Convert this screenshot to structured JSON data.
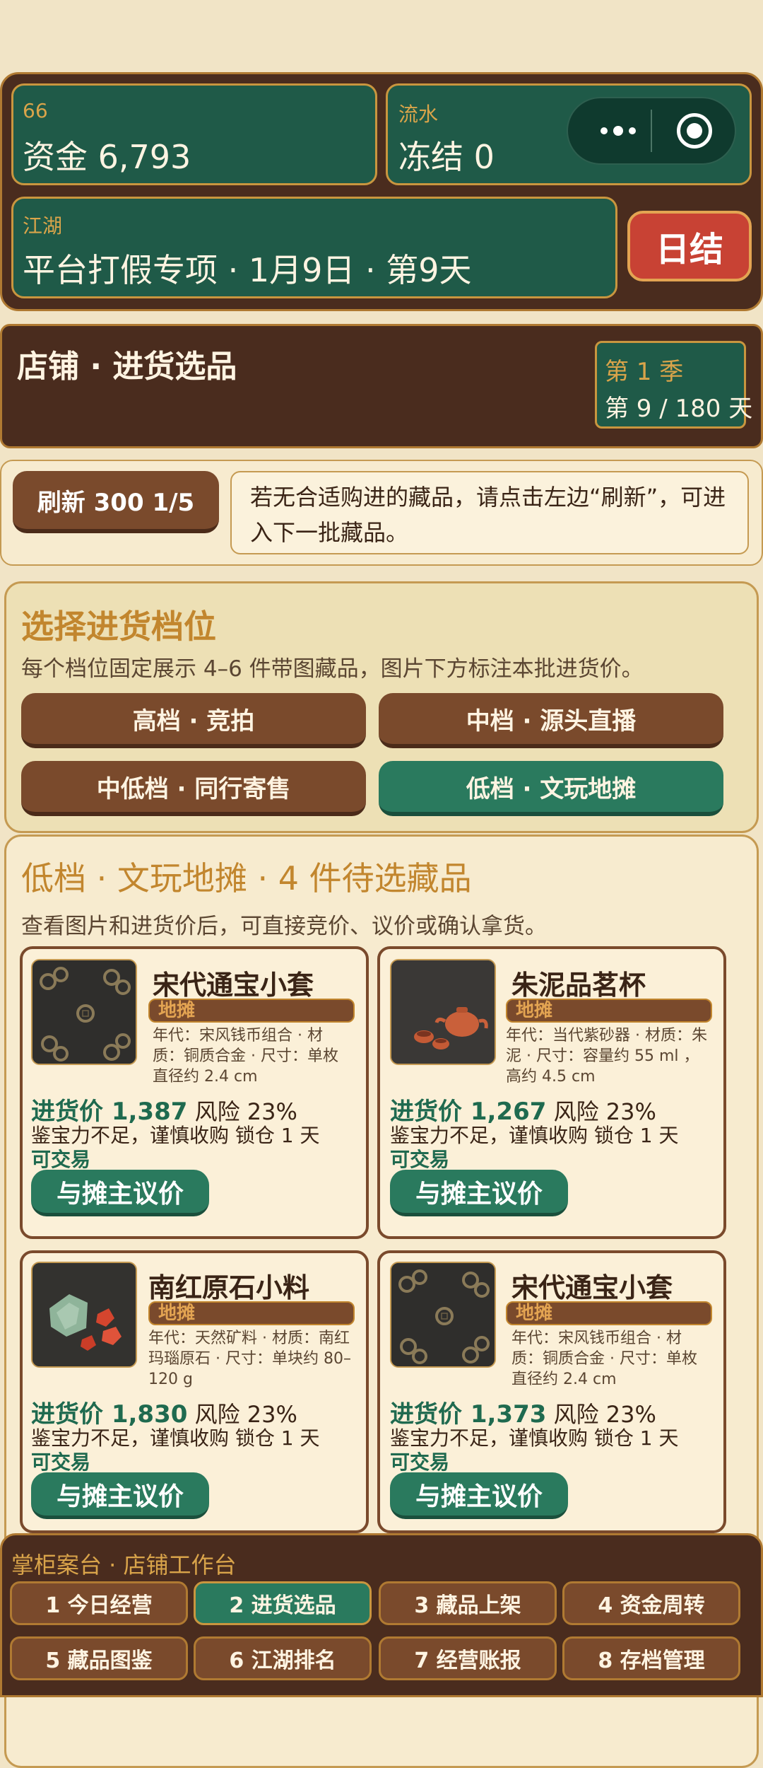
{
  "colors": {
    "background": "#f1e4c6",
    "panel_brown": "#4a2c1e",
    "card_green": "#1f5a48",
    "accent_gold": "#c9963f",
    "settle_red": "#c84234",
    "button_brown": "#7a4a2c",
    "active_green": "#2a7a5e"
  },
  "header": {
    "player_label": "66",
    "funds_text": "资金 6,793",
    "flow_label": "流水",
    "frozen_text": "冻结 0",
    "jianghu_label": "江湖",
    "event_text": "平台打假专项 · 1月9日 · 第9天",
    "settle_label": "日结",
    "capsule_more_icon": "more-dots-icon",
    "capsule_close_icon": "target-close-icon"
  },
  "shop": {
    "title": "店铺 · 进货选品",
    "season_label": "第 1 季",
    "day_progress": "第 9 / 180 天"
  },
  "refresh": {
    "button_label": "刷新 300 1/5",
    "tip": "若无合适购进的藏品，请点击左边“刷新”，可进入下一批藏品。"
  },
  "tiers": {
    "title": "选择进货档位",
    "description": "每个档位固定展示 4–6 件带图藏品，图片下方标注本批进货价。",
    "buttons": [
      {
        "label": "高档 · 竞拍"
      },
      {
        "label": "中档 · 源头直播"
      },
      {
        "label": "中低档 · 同行寄售"
      },
      {
        "label": "低档 · 文玩地摊"
      }
    ],
    "active_index": 3
  },
  "listing": {
    "title": "低档 · 文玩地摊 · 4 件待选藏品",
    "description": "查看图片和进货价后，可直接竞价、议价或确认拿货。",
    "items": [
      {
        "name": "宋代通宝小套",
        "tag": "地摊",
        "meta": "年代：宋风钱币组合 · 材质：铜质合金 · 尺寸：单枚直径约 2.4 cm",
        "price_label": "进货价 1,387",
        "risk": "风险 23%",
        "warning": "鉴宝力不足，谨慎收购 锁仓 1 天",
        "status": "可交易",
        "action": "与摊主议价",
        "image": "coins"
      },
      {
        "name": "朱泥品茗杯",
        "tag": "地摊",
        "meta": "年代：当代紫砂器 · 材质：朱泥 · 尺寸：容量约 55 ml ，高约 4.5 cm",
        "price_label": "进货价 1,267",
        "risk": "风险 23%",
        "warning": "鉴宝力不足，谨慎收购 锁仓 1 天",
        "status": "可交易",
        "action": "与摊主议价",
        "image": "teapot"
      },
      {
        "name": "南红原石小料",
        "tag": "地摊",
        "meta": "年代：天然矿料 · 材质：南红玛瑙原石 · 尺寸：单块约 80–120 g",
        "price_label": "进货价 1,830",
        "risk": "风险 23%",
        "warning": "鉴宝力不足，谨慎收购 锁仓 1 天",
        "status": "可交易",
        "action": "与摊主议价",
        "image": "stones"
      },
      {
        "name": "宋代通宝小套",
        "tag": "地摊",
        "meta": "年代：宋风钱币组合 · 材质：铜质合金 · 尺寸：单枚直径约 2.4 cm",
        "price_label": "进货价 1,373",
        "risk": "风险 23%",
        "warning": "鉴宝力不足，谨慎收购 锁仓 1 天",
        "status": "可交易",
        "action": "与摊主议价",
        "image": "coins"
      }
    ]
  },
  "bottom_nav": {
    "heading": "掌柜案台 · 店铺工作台",
    "tabs": [
      {
        "label": "1 今日经营"
      },
      {
        "label": "2 进货选品"
      },
      {
        "label": "3 藏品上架"
      },
      {
        "label": "4 资金周转"
      },
      {
        "label": "5 藏品图鉴"
      },
      {
        "label": "6 江湖排名"
      },
      {
        "label": "7 经营账报"
      },
      {
        "label": "8 存档管理"
      }
    ],
    "active_index": 1
  }
}
